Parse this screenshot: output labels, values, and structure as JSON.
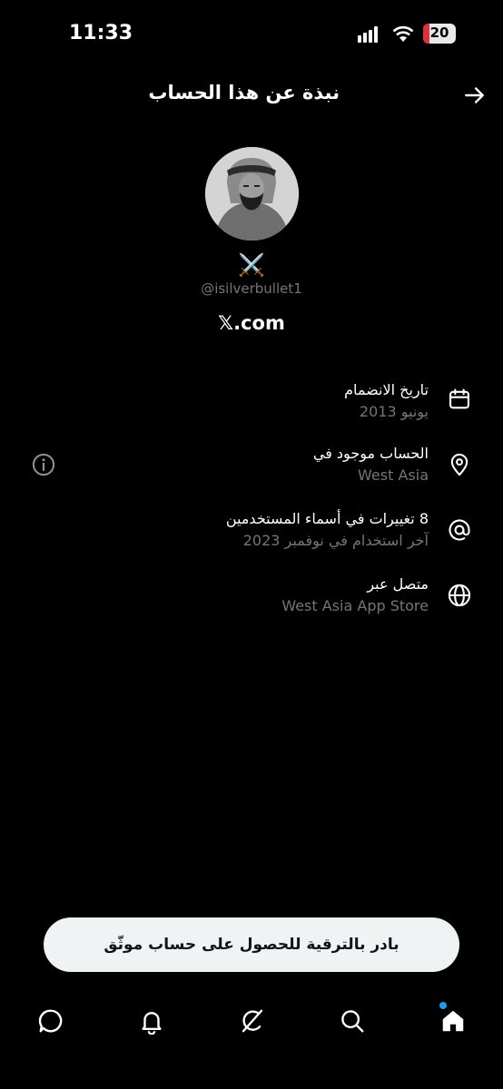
{
  "status": {
    "time": "11:33",
    "battery_level": "20"
  },
  "header": {
    "title": "نبذة عن هذا الحساب",
    "back_icon": "arrow-right-icon"
  },
  "profile": {
    "emoji": "⚔️",
    "handle": "@isilverbullet1",
    "website": "𝕏.com"
  },
  "rows": [
    {
      "icon": "calendar-icon",
      "title": "تاريخ الانضمام",
      "subtitle": "يونيو 2013"
    },
    {
      "icon": "location-pin-icon",
      "title": "الحساب موجود في",
      "subtitle": "West Asia"
    },
    {
      "icon": "at-sign-icon",
      "title": "8 تغييرات في أسماء المستخدمين",
      "subtitle": "آخر استخدام في نوفمبر 2023"
    },
    {
      "icon": "globe-icon",
      "title": "متصل عبر",
      "subtitle": "West Asia App Store"
    }
  ],
  "upgrade_button": "بادر بالترقية للحصول على حساب موثّق",
  "bottom_nav": [
    "home-icon",
    "search-icon",
    "grok-icon",
    "notifications-icon",
    "messages-icon"
  ],
  "colors": {
    "background": "#000000",
    "text": "#ffffff",
    "secondary": "#71767b",
    "accent_dot": "#1d9bf0",
    "battery_low": "#e0303a"
  }
}
